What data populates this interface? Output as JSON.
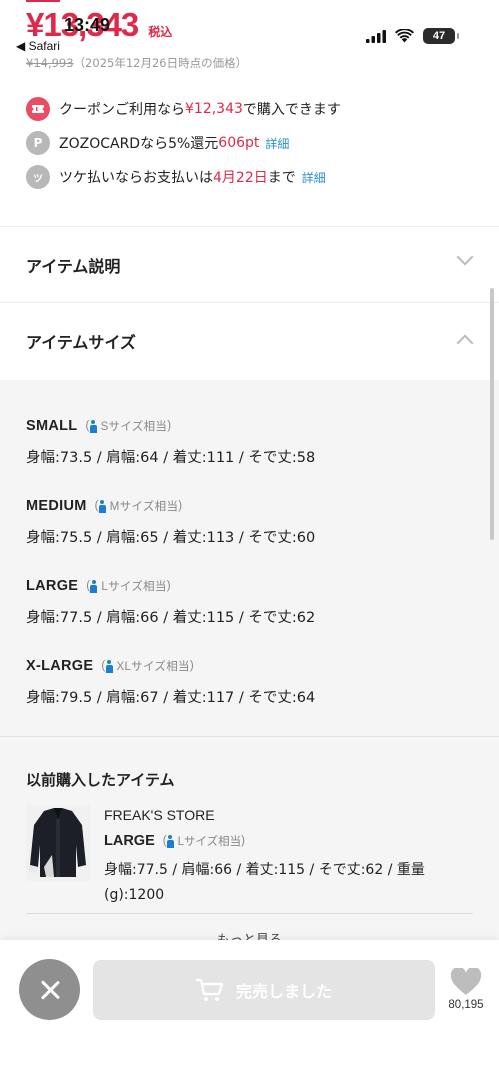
{
  "status_bar": {
    "time": "13:49",
    "back_label": "◀ Safari",
    "battery": "47"
  },
  "price": {
    "current": "¥13,343",
    "tax": "税込",
    "old_price": "¥14,993",
    "old_note": "（2025年12月26日時点の価格）"
  },
  "benefits": [
    {
      "icon": "coupon-icon",
      "pre": "クーポンご利用なら",
      "highlight": "¥12,343",
      "post": "で購入できます",
      "link": ""
    },
    {
      "icon": "zozopoint-icon",
      "pre": "ZOZOCARDなら5%還元 ",
      "highlight": "606pt",
      "post": "",
      "link": "詳細"
    },
    {
      "icon": "tsuke-icon",
      "pre": "ツケ払いならお支払いは",
      "highlight": "4月22日",
      "post": "まで",
      "link": "詳細"
    }
  ],
  "sections": {
    "description": "アイテム説明",
    "sizes": "アイテムサイズ"
  },
  "sizes": [
    {
      "name": "SMALL",
      "equiv": "Sサイズ相当",
      "measurements": "身幅:73.5 / 肩幅:64 / 着丈:111 / そで丈:58"
    },
    {
      "name": "MEDIUM",
      "equiv": "Mサイズ相当",
      "measurements": "身幅:75.5 / 肩幅:65 / 着丈:113 / そで丈:60"
    },
    {
      "name": "LARGE",
      "equiv": "Lサイズ相当",
      "measurements": "身幅:77.5 / 肩幅:66 / 着丈:115 / そで丈:62"
    },
    {
      "name": "X-LARGE",
      "equiv": "XLサイズ相当",
      "measurements": "身幅:79.5 / 肩幅:67 / 着丈:117 / そで丈:64"
    }
  ],
  "previous_purchase": {
    "title": "以前購入したアイテム",
    "brand": "FREAK'S STORE",
    "size": "LARGE",
    "equiv": "Lサイズ相当",
    "measurements": "身幅:77.5 / 肩幅:66 / 着丈:115 / そで丈:62 / 重量(g):1200",
    "more_label": "もっと見る"
  },
  "bottom_bar": {
    "soldout_label": "完売しました",
    "favorite_count": "80,195"
  },
  "colors": {
    "accent_red": "#e0294a",
    "link_blue": "#2b8fd6"
  }
}
